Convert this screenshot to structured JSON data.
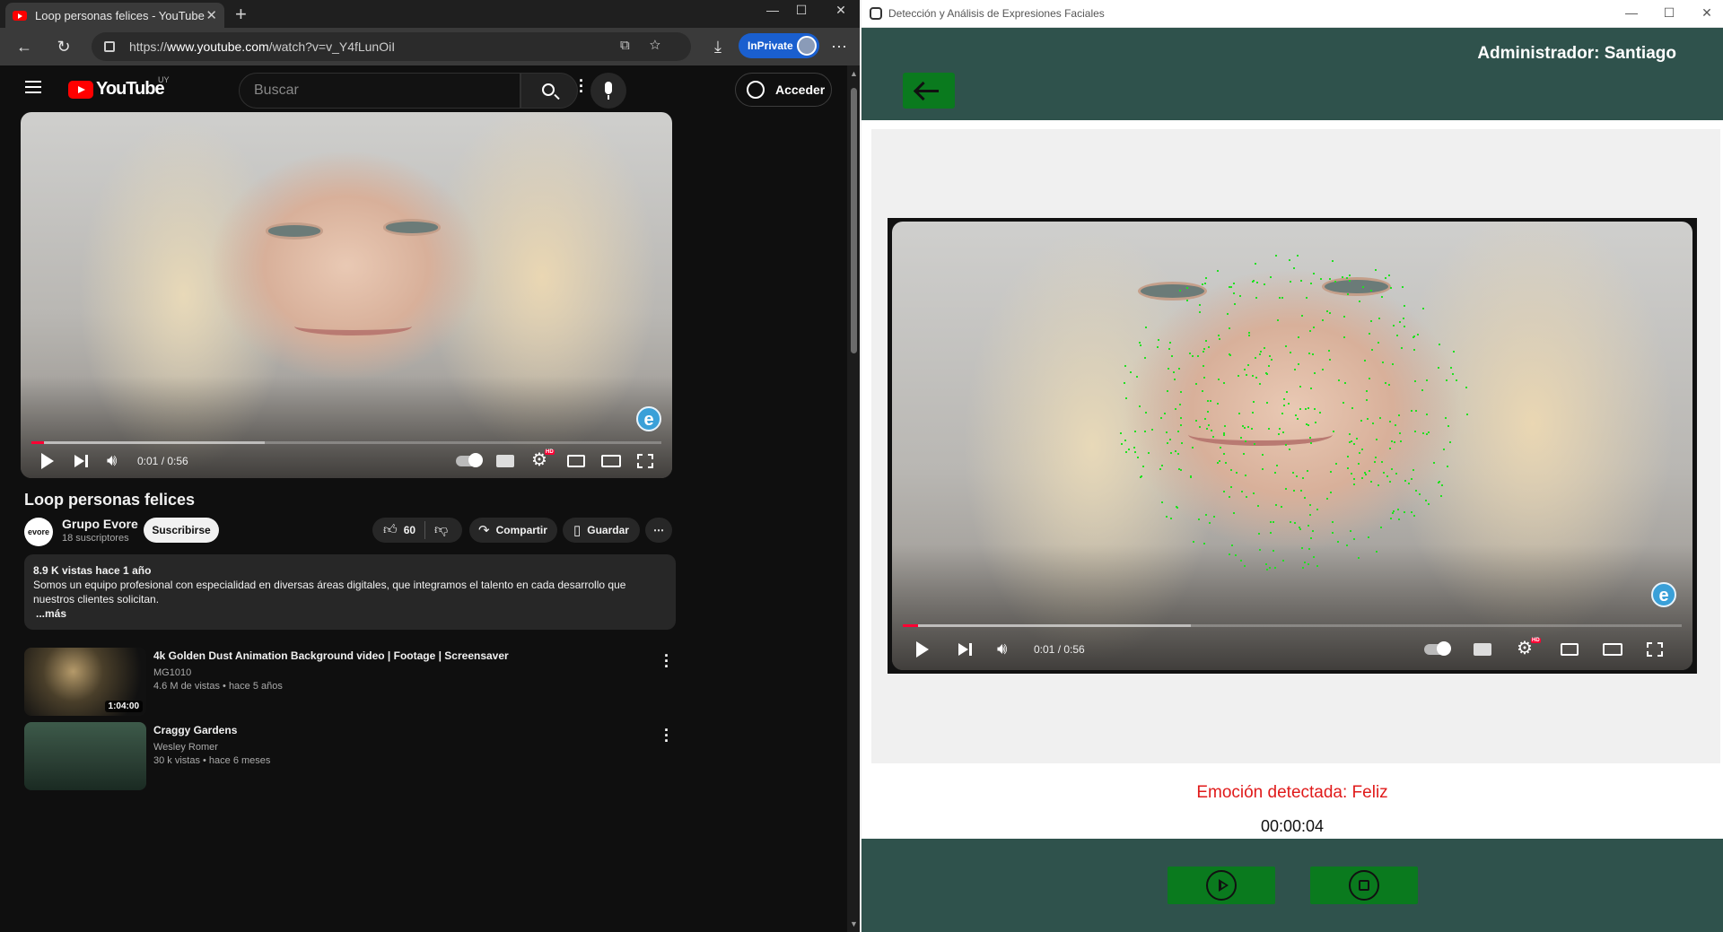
{
  "browser": {
    "tab_title": "Loop personas felices - YouTube",
    "url_scheme": "https://",
    "url_host": "www.youtube.com",
    "url_path": "/watch?v=v_Y4fLunOiI",
    "inprivate_label": "InPrivate",
    "window_controls": [
      "—",
      "☐",
      "✕"
    ],
    "accent_color": "#1a5fcf"
  },
  "youtube": {
    "logo_text": "YouTube",
    "country_code": "UY",
    "search_placeholder": "Buscar",
    "signin_label": "Acceder",
    "video": {
      "title": "Loop personas felices",
      "time": "0:01 / 0:56",
      "progress": 0.02,
      "buffered": 0.37
    },
    "channel": {
      "logo_text": "evore",
      "name": "Grupo Evore",
      "subscribers": "18 suscriptores",
      "subscribe_label": "Suscribirse"
    },
    "actions": {
      "likes": "60",
      "share": "Compartir",
      "save": "Guardar"
    },
    "description": {
      "meta": "8.9 K vistas  hace 1 año",
      "text": "Somos un equipo profesional con especialidad en diversas áreas digitales, que integramos el talento en cada desarrollo que nuestros clientes solicitan.",
      "more": "...más"
    },
    "related": [
      {
        "title": "4k Golden Dust Animation Background video | Footage | Screensaver",
        "channel": "MG1010",
        "meta": "4.6 M de vistas  • hace 5 años",
        "duration": "1:04:00"
      },
      {
        "title": "Craggy Gardens",
        "channel": "Wesley Romer",
        "meta": "30 k vistas  • hace 6 meses",
        "duration": ""
      }
    ]
  },
  "app": {
    "window_title": "Detección y Análisis de Expresiones Faciales",
    "admin_label": "Administrador: Santiago",
    "emotion_text": "Emoción detectada: Feliz",
    "timer": "00:00:04",
    "header_color": "#2f524c",
    "button_color": "#0a7a1e",
    "emotion_color": "#e01a1a",
    "video_time": "0:01 / 0:56"
  },
  "icons": [
    "menu-icon",
    "search-icon",
    "mic-icon",
    "user-icon",
    "play-icon",
    "next-icon",
    "volume-icon",
    "autoplay-toggle-icon",
    "subtitles-icon",
    "settings-icon",
    "miniplayer-icon",
    "theater-icon",
    "fullscreen-icon",
    "like-icon",
    "dislike-icon",
    "share-icon",
    "save-icon",
    "back-arrow-icon",
    "stop-icon"
  ]
}
